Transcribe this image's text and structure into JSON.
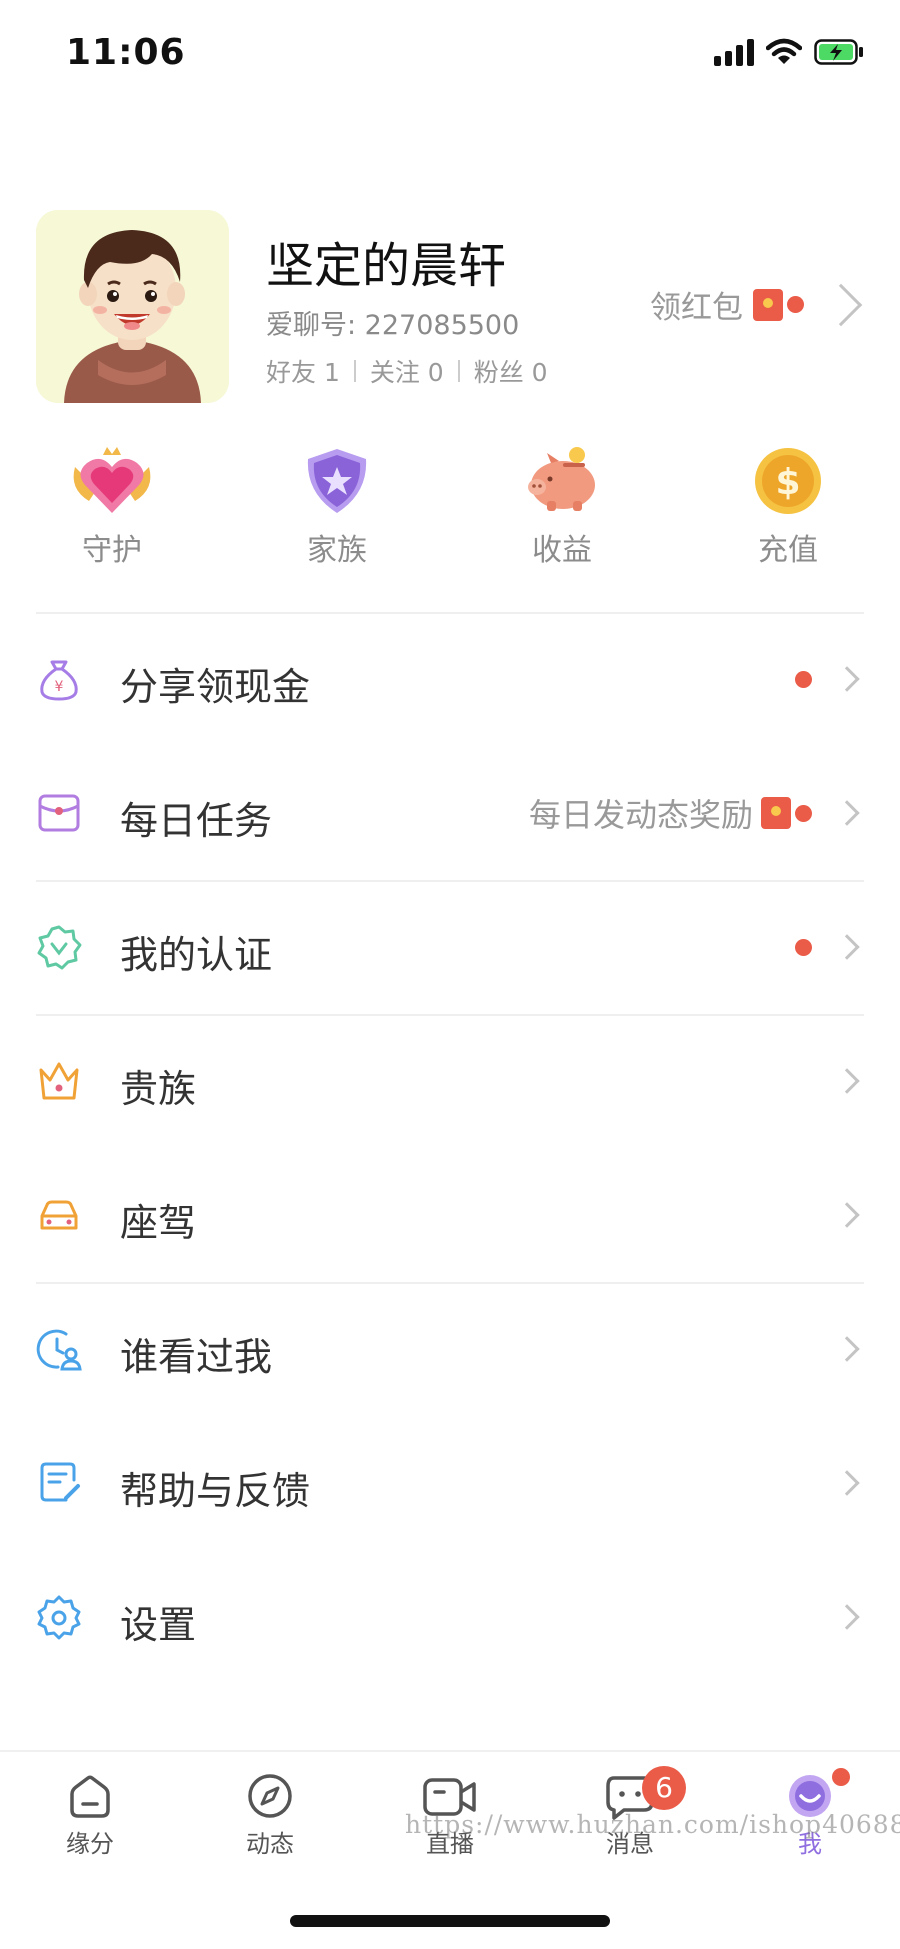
{
  "status_bar": {
    "time": "11:06"
  },
  "profile": {
    "nickname": "坚定的晨轩",
    "user_id": "爱聊号: 227085500",
    "stats": [
      "好友 1",
      "关注 0",
      "粉丝 0"
    ],
    "red_packet_label": "领红包"
  },
  "quick_actions": [
    {
      "label": "守护",
      "icon": "heart-shield-icon"
    },
    {
      "label": "家族",
      "icon": "star-shield-icon"
    },
    {
      "label": "收益",
      "icon": "piggy-bank-icon"
    },
    {
      "label": "充值",
      "icon": "dollar-coin-icon"
    }
  ],
  "menu": [
    {
      "label": "分享领现金",
      "icon": "money-bag-icon",
      "note": "",
      "dot": true
    },
    {
      "label": "每日任务",
      "icon": "envelope-icon",
      "note": "每日发动态奖励",
      "dot": true
    },
    {
      "label": "我的认证",
      "icon": "verified-badge-icon",
      "note": "",
      "dot": true
    },
    {
      "label": "贵族",
      "icon": "crown-icon",
      "note": "",
      "dot": false
    },
    {
      "label": "座驾",
      "icon": "car-icon",
      "note": "",
      "dot": false
    },
    {
      "label": "谁看过我",
      "icon": "clock-user-icon",
      "note": "",
      "dot": false
    },
    {
      "label": "帮助与反馈",
      "icon": "edit-doc-icon",
      "note": "",
      "dot": false
    },
    {
      "label": "设置",
      "icon": "gear-icon",
      "note": "",
      "dot": false
    }
  ],
  "tab_bar": {
    "tabs": [
      {
        "label": "缘分",
        "icon": "home-icon"
      },
      {
        "label": "动态",
        "icon": "compass-icon"
      },
      {
        "label": "直播",
        "icon": "video-camera-icon"
      },
      {
        "label": "消息",
        "icon": "chat-bubble-icon",
        "badge": "6"
      },
      {
        "label": "我",
        "icon": "smile-face-icon",
        "active": true
      }
    ]
  },
  "watermark": "https://www.huzhan.com/ishop40688",
  "colors": {
    "accent": "#8f6ee0",
    "red_dot": "#ea5b48",
    "divider": "#efefef"
  }
}
